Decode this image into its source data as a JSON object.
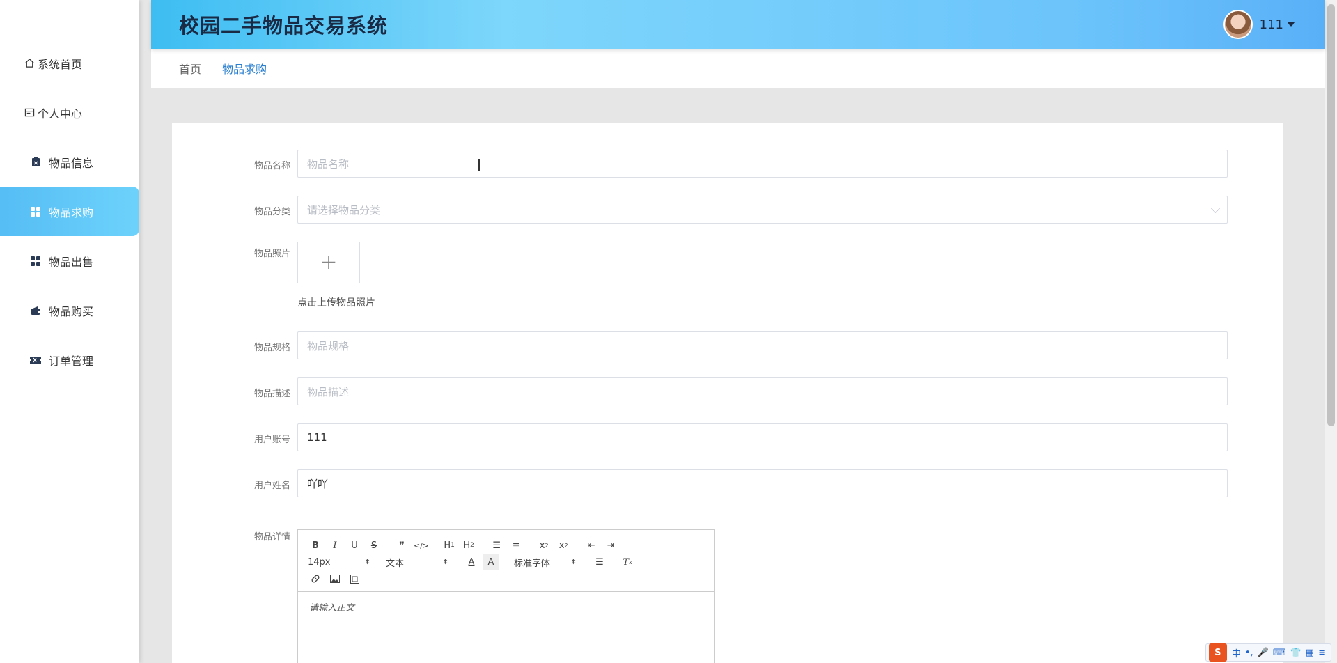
{
  "app": {
    "title": "校园二手物品交易系统"
  },
  "user": {
    "name": "111"
  },
  "sidebar": {
    "items": [
      {
        "label": "系统首页",
        "icon": "home-icon"
      },
      {
        "label": "个人中心",
        "icon": "profile-card-icon"
      },
      {
        "label": "物品信息",
        "icon": "clipboard-icon"
      },
      {
        "label": "物品求购",
        "icon": "grid-icon",
        "active": true
      },
      {
        "label": "物品出售",
        "icon": "grid-icon"
      },
      {
        "label": "物品购买",
        "icon": "wallet-icon"
      },
      {
        "label": "订单管理",
        "icon": "ticket-icon"
      }
    ]
  },
  "breadcrumb": {
    "home": "首页",
    "current": "物品求购"
  },
  "form": {
    "name": {
      "label": "物品名称",
      "placeholder": "物品名称",
      "value": ""
    },
    "category": {
      "label": "物品分类",
      "placeholder": "请选择物品分类"
    },
    "photo": {
      "label": "物品照片",
      "upload_tip": "点击上传物品照片",
      "plus": "+"
    },
    "spec": {
      "label": "物品规格",
      "placeholder": "物品规格"
    },
    "desc": {
      "label": "物品描述",
      "placeholder": "物品描述"
    },
    "account": {
      "label": "用户账号",
      "value": "111"
    },
    "username": {
      "label": "用户姓名",
      "value": "吖吖"
    },
    "details": {
      "label": "物品详情",
      "font_size": "14px",
      "text_type": "文本",
      "font_family": "标准字体",
      "placeholder": "请输入正文"
    }
  },
  "ime": {
    "logo": "S",
    "mode": "中"
  },
  "colors": {
    "accent": "#56bdf5",
    "link": "#2a7fd0",
    "header_start": "#3dbdf2",
    "header_end": "#5ab0f7"
  }
}
